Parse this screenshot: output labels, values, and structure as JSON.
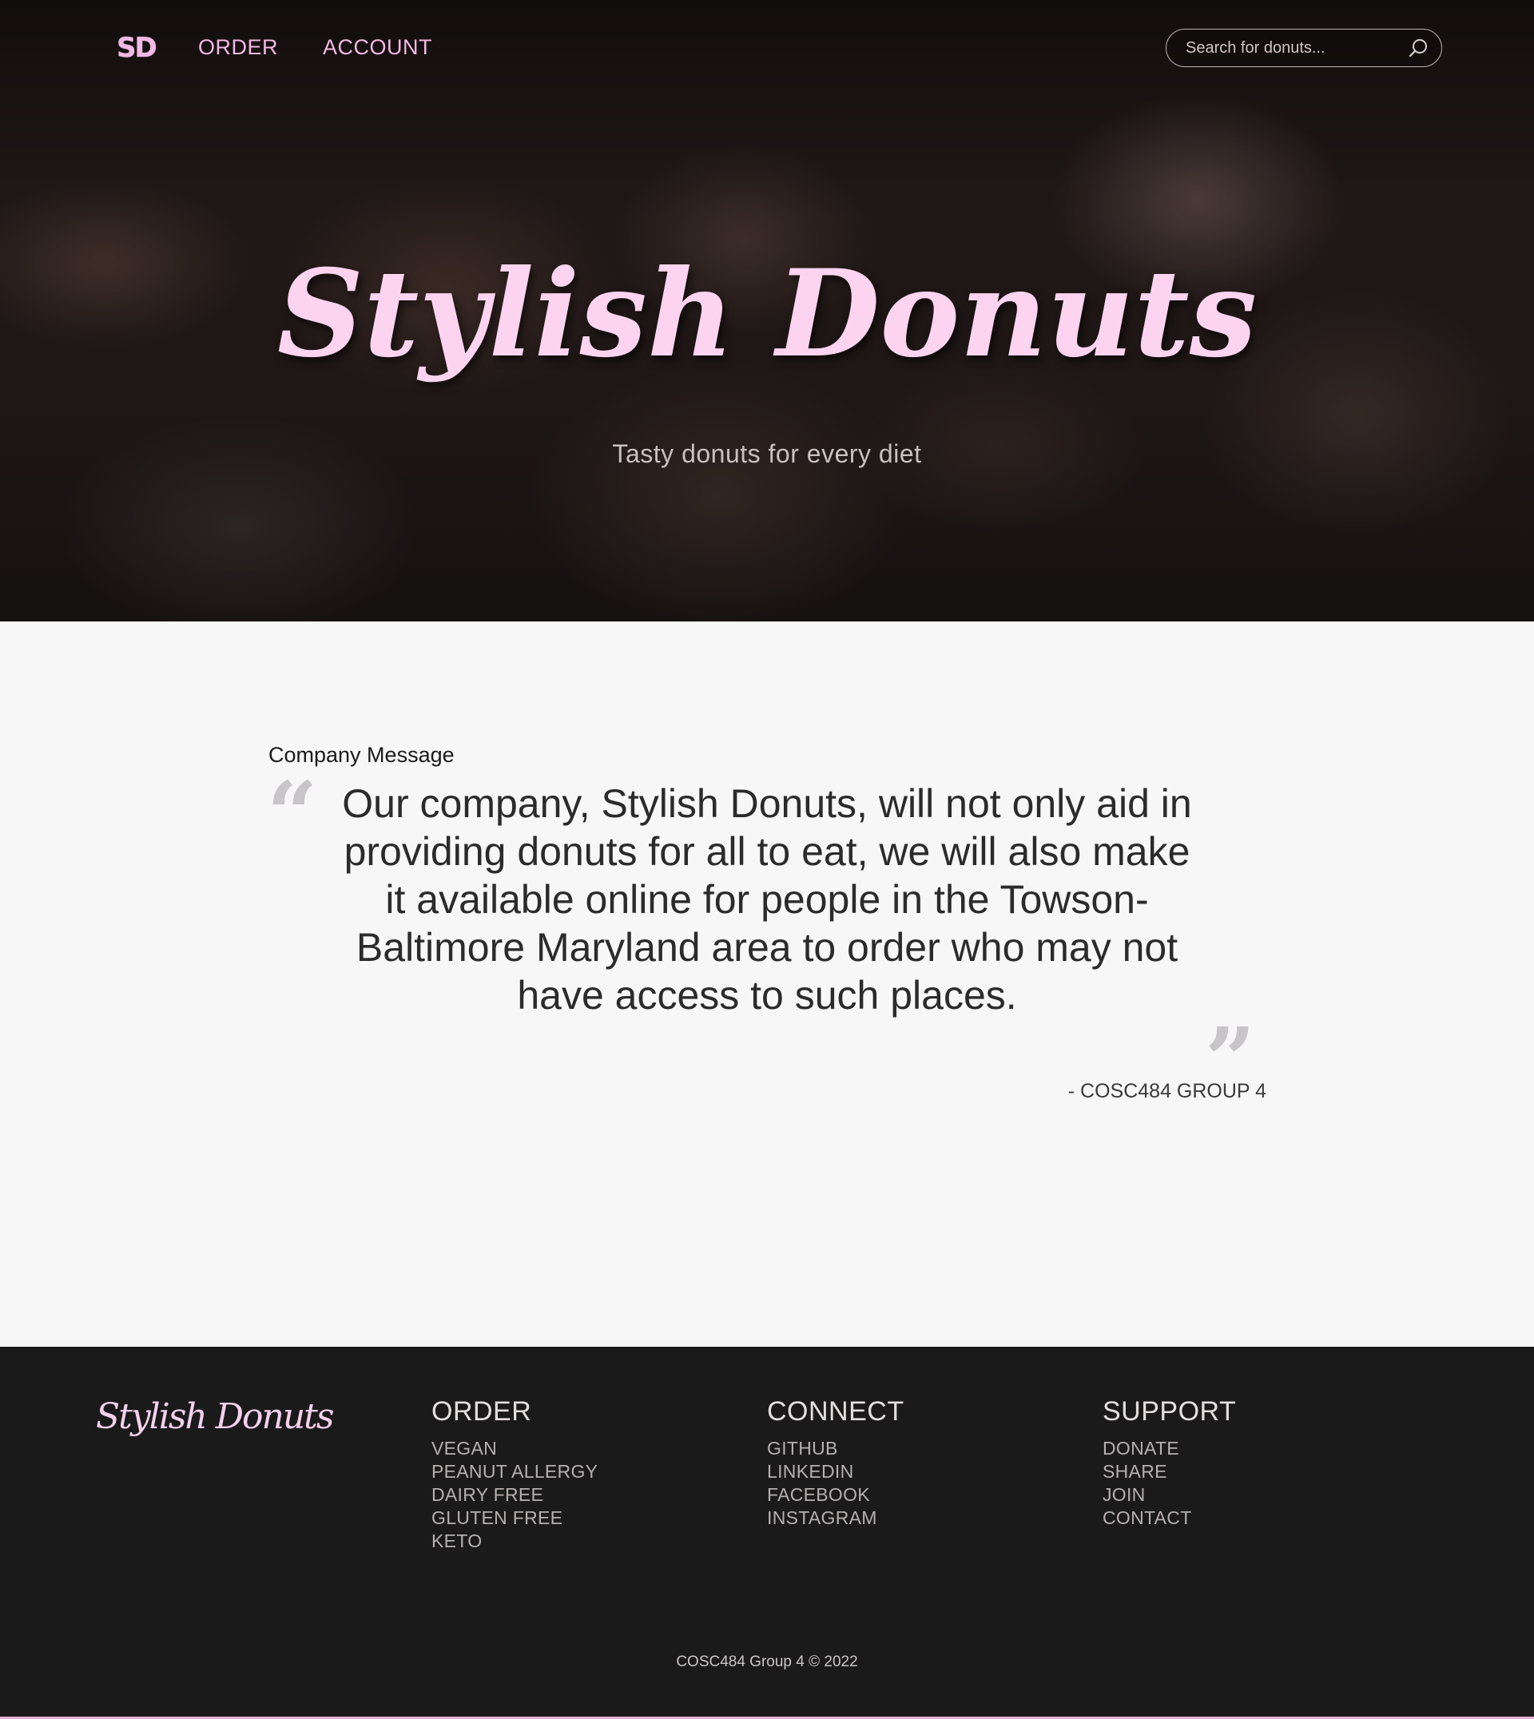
{
  "header": {
    "logo": "SD",
    "nav": [
      {
        "label": "ORDER"
      },
      {
        "label": "ACCOUNT"
      }
    ],
    "search": {
      "placeholder": "Search for donuts...",
      "value": "",
      "icon": "search-icon"
    }
  },
  "hero": {
    "title": "Stylish Donuts",
    "subtitle": "Tasty donuts for every diet"
  },
  "message": {
    "label": "Company Message",
    "quote": "Our company, Stylish Donuts, will not only aid in providing donuts for all to eat, we will also make it available online for people in the Towson-Baltimore Maryland area to order who may not have access to such places.",
    "author": "- COSC484 GROUP 4"
  },
  "footer": {
    "brand": "Stylish Donuts",
    "columns": [
      {
        "heading": "ORDER",
        "links": [
          "VEGAN",
          "PEANUT ALLERGY",
          "DAIRY FREE",
          "GLUTEN FREE",
          "KETO"
        ]
      },
      {
        "heading": "CONNECT",
        "links": [
          "GITHUB",
          "LINKEDIN",
          "FACEBOOK",
          "INSTAGRAM"
        ]
      },
      {
        "heading": "SUPPORT",
        "links": [
          "DONATE",
          "SHARE",
          "JOIN",
          "CONTACT"
        ]
      }
    ],
    "copyright": "COSC484 Group 4 © 2022"
  },
  "colors": {
    "accent_pink": "#f3b8e2",
    "title_pink": "#fcd4f0",
    "footer_bg": "#1b1a1b",
    "page_bg": "#f8f7f8"
  }
}
